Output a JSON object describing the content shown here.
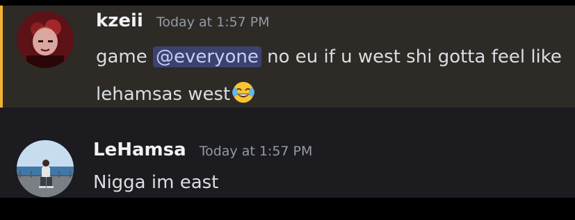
{
  "colors": {
    "highlight_bar": "#f0b232",
    "highlight_bg": "#2e2b27",
    "chat_bg": "#1b1b20",
    "mention_bg": "#3c4270",
    "mention_text": "#c9cdfb"
  },
  "messages": [
    {
      "username": "kzeii",
      "timestamp": "Today at 1:57 PM",
      "text_before": "game",
      "mention": "@everyone",
      "text_after": "no eu if u west shi gotta feel like lehamsas west",
      "emoji": "face-with-tears-of-joy"
    },
    {
      "username": "LeHamsa",
      "timestamp": "Today at 1:57 PM",
      "text": "Nigga im east"
    }
  ]
}
